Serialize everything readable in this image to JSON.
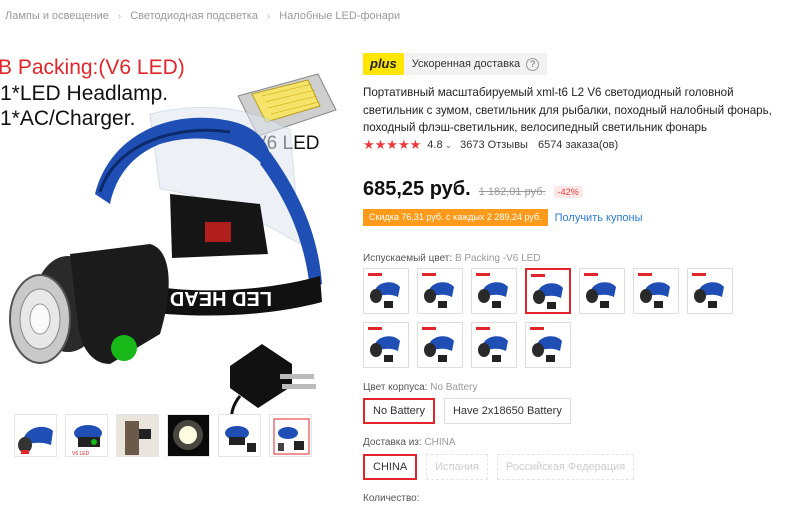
{
  "breadcrumb": {
    "items": [
      "Лампы и освещение",
      "Светодиодная подсветка",
      "Налобные LED-фонари"
    ],
    "separator": "›"
  },
  "gallery": {
    "main_text": {
      "line1": "B Packing:(V6 LED)",
      "line2": "1*LED Headlamp.",
      "line3": "1*AC/Charger.",
      "chip_label": "V6 LED",
      "strap_text": "LED HEAD"
    },
    "thumbnails": [
      "thumb-1",
      "thumb-2",
      "thumb-3",
      "thumb-4",
      "thumb-5",
      "thumb-6"
    ]
  },
  "delivery": {
    "badge": "plus",
    "text": "Ускоренная доставка",
    "help": "?"
  },
  "product": {
    "title": "Портативный масштабируемый xml-t6 L2 V6 светодиодный головной светильник с зумом, светильник для рыбалки, походный налобный фонарь, походный флэш-светильник, велосипедный светильник фонарь"
  },
  "rating": {
    "stars": "★★★★★",
    "value": "4.8",
    "chevron": "⌄",
    "reviews": "3673 Отзывы",
    "orders": "6574 заказа(ов)"
  },
  "price": {
    "current": "685,25 руб.",
    "old": "1 182,01 руб.",
    "discount": "-42%"
  },
  "coupon": {
    "tag": "Скидка 76,31 руб. с каждых 2 289,24 руб.",
    "link": "Получить купоны"
  },
  "color": {
    "label": "Испускаемый цвет:",
    "value": "B Packing -V6 LED",
    "selected_index": 3,
    "swatch_count": 11
  },
  "body_color": {
    "label": "Цвет корпуса:",
    "value": "No Battery",
    "options": [
      {
        "label": "No Battery",
        "state": "selected"
      },
      {
        "label": "Have 2x18650 Battery",
        "state": "normal"
      }
    ]
  },
  "ship_from": {
    "label": "Доставка из:",
    "value": "CHINA",
    "options": [
      {
        "label": "CHINA",
        "state": "selected"
      },
      {
        "label": "Испания",
        "state": "disabled"
      },
      {
        "label": "Российская Федерация",
        "state": "disabled"
      }
    ]
  },
  "quantity": {
    "label": "Количество:"
  },
  "colors": {
    "accent_red": "#e0262a",
    "plus_yellow": "#ffe600",
    "coupon_orange": "#ff9a1a",
    "link_blue": "#2b7bd9",
    "strap_blue": "#1f4fb5"
  }
}
